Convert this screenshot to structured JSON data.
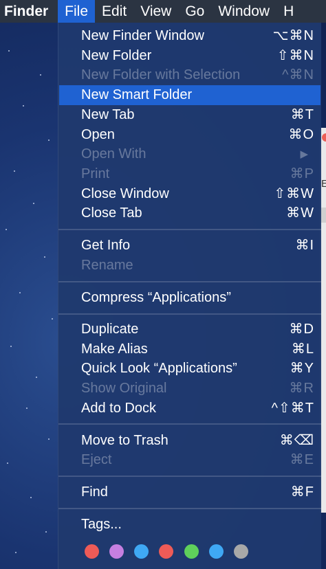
{
  "menubar": {
    "items": [
      "Finder",
      "File",
      "Edit",
      "View",
      "Go",
      "Window",
      "H"
    ]
  },
  "behind": {
    "letter": "E"
  },
  "file_menu": {
    "group1": [
      {
        "label": "New Finder Window",
        "shortcut": "⌥⌘N"
      },
      {
        "label": "New Folder",
        "shortcut": "⇧⌘N"
      },
      {
        "label": "New Folder with Selection",
        "shortcut": "^⌘N"
      },
      {
        "label": "New Smart Folder",
        "shortcut": ""
      },
      {
        "label": "New Tab",
        "shortcut": "⌘T"
      },
      {
        "label": "Open",
        "shortcut": "⌘O"
      },
      {
        "label": "Open With",
        "shortcut": "▶"
      },
      {
        "label": "Print",
        "shortcut": "⌘P"
      },
      {
        "label": "Close Window",
        "shortcut": "⇧⌘W"
      },
      {
        "label": "Close Tab",
        "shortcut": "⌘W"
      }
    ],
    "group2": [
      {
        "label": "Get Info",
        "shortcut": "⌘I"
      },
      {
        "label": "Rename",
        "shortcut": ""
      }
    ],
    "group3": [
      {
        "label": "Compress “Applications”",
        "shortcut": ""
      }
    ],
    "group4": [
      {
        "label": "Duplicate",
        "shortcut": "⌘D"
      },
      {
        "label": "Make Alias",
        "shortcut": "⌘L"
      },
      {
        "label": "Quick Look “Applications”",
        "shortcut": "⌘Y"
      },
      {
        "label": "Show Original",
        "shortcut": "⌘R"
      },
      {
        "label": "Add to Dock",
        "shortcut": "^⇧⌘T"
      }
    ],
    "group5": [
      {
        "label": "Move to Trash",
        "shortcut": "⌘⌫"
      },
      {
        "label": "Eject",
        "shortcut": "⌘E"
      }
    ],
    "group6": [
      {
        "label": "Find",
        "shortcut": "⌘F"
      }
    ],
    "group7": [
      {
        "label": "Tags...",
        "shortcut": ""
      }
    ],
    "highlighted_item": "New Smart Folder",
    "disabled_items": [
      "New Folder with Selection",
      "Open With",
      "Print",
      "Rename",
      "Show Original",
      "Eject"
    ]
  },
  "tag_colors": [
    {
      "name": "red",
      "color": "#ee5b57"
    },
    {
      "name": "purple",
      "color": "#c57fe0"
    },
    {
      "name": "blue",
      "color": "#3fa8f4"
    },
    {
      "name": "red",
      "color": "#ee5b57"
    },
    {
      "name": "green",
      "color": "#5fd05b"
    },
    {
      "name": "blue",
      "color": "#3fa8f4"
    },
    {
      "name": "gray",
      "color": "#a8a8a8"
    }
  ]
}
